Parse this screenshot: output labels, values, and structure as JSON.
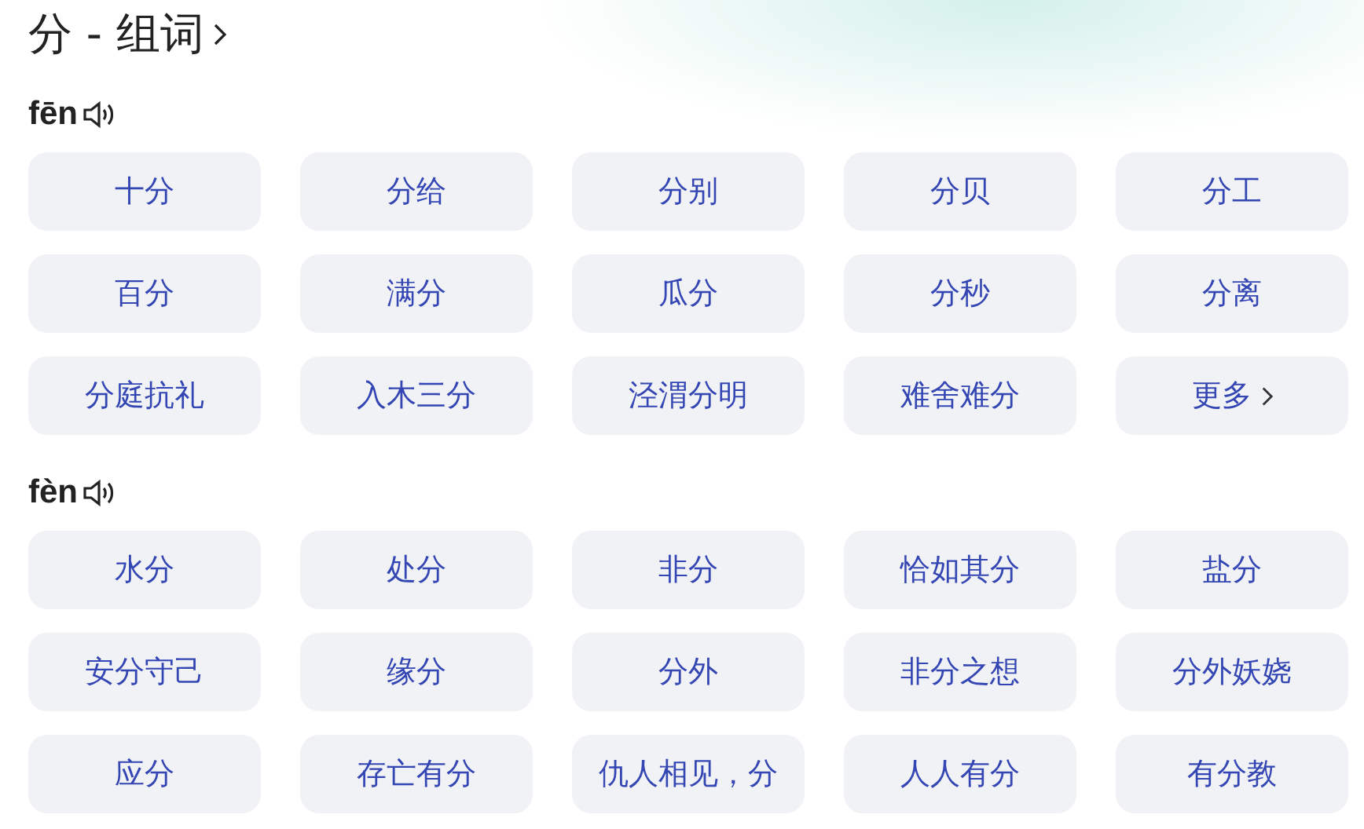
{
  "title": "分 - 组词",
  "sections": [
    {
      "pinyin": "fēn",
      "words": [
        {
          "text": "十分",
          "kind": "word"
        },
        {
          "text": "分给",
          "kind": "word"
        },
        {
          "text": "分别",
          "kind": "word"
        },
        {
          "text": "分贝",
          "kind": "word"
        },
        {
          "text": "分工",
          "kind": "word"
        },
        {
          "text": "百分",
          "kind": "word"
        },
        {
          "text": "满分",
          "kind": "word"
        },
        {
          "text": "瓜分",
          "kind": "word"
        },
        {
          "text": "分秒",
          "kind": "word"
        },
        {
          "text": "分离",
          "kind": "word"
        },
        {
          "text": "分庭抗礼",
          "kind": "word"
        },
        {
          "text": "入木三分",
          "kind": "word"
        },
        {
          "text": "泾渭分明",
          "kind": "word"
        },
        {
          "text": "难舍难分",
          "kind": "word"
        },
        {
          "text": "更多",
          "kind": "more"
        }
      ]
    },
    {
      "pinyin": "fèn",
      "words": [
        {
          "text": "水分",
          "kind": "word"
        },
        {
          "text": "处分",
          "kind": "word"
        },
        {
          "text": "非分",
          "kind": "word"
        },
        {
          "text": "恰如其分",
          "kind": "word"
        },
        {
          "text": "盐分",
          "kind": "word"
        },
        {
          "text": "安分守己",
          "kind": "word"
        },
        {
          "text": "缘分",
          "kind": "word"
        },
        {
          "text": "分外",
          "kind": "word"
        },
        {
          "text": "非分之想",
          "kind": "word"
        },
        {
          "text": "分外妖娆",
          "kind": "word"
        },
        {
          "text": "应分",
          "kind": "word"
        },
        {
          "text": "存亡有分",
          "kind": "word"
        },
        {
          "text": "仇人相见，分",
          "kind": "word"
        },
        {
          "text": "人人有分",
          "kind": "word"
        },
        {
          "text": "有分教",
          "kind": "word"
        }
      ]
    }
  ]
}
